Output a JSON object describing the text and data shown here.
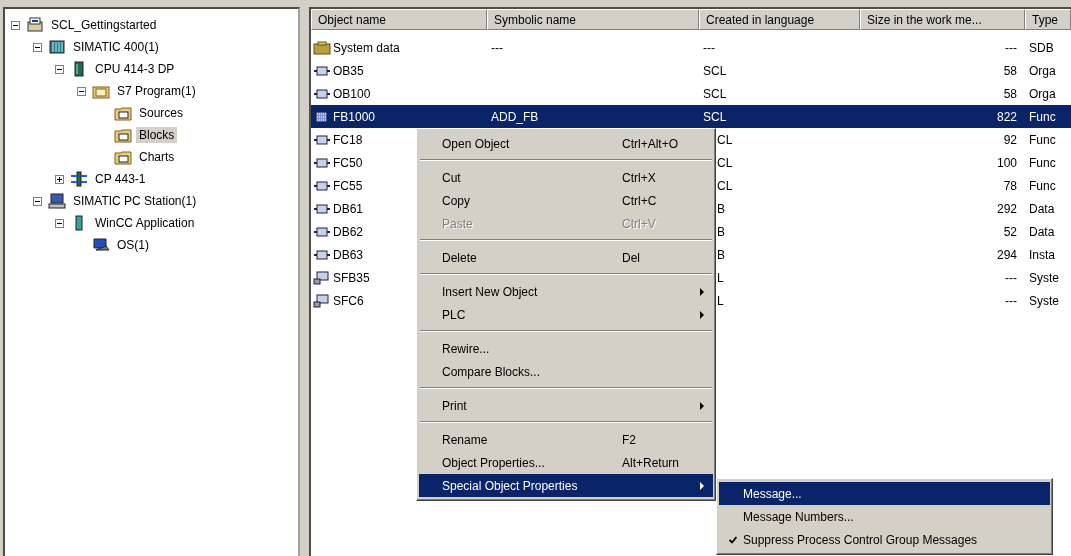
{
  "tree": [
    {
      "label": "SCL_Gettingstarted",
      "kind": "project",
      "expanded": true,
      "selected": false,
      "children": [
        {
          "label": "SIMATIC 400(1)",
          "kind": "station",
          "expanded": true,
          "selected": false,
          "children": [
            {
              "label": "CPU 414-3 DP",
              "kind": "cpu",
              "expanded": true,
              "selected": false,
              "children": [
                {
                  "label": "S7 Program(1)",
                  "kind": "program",
                  "expanded": true,
                  "selected": false,
                  "children": [
                    {
                      "label": "Sources",
                      "kind": "folder",
                      "selected": false
                    },
                    {
                      "label": "Blocks",
                      "kind": "folder",
                      "selected": true
                    },
                    {
                      "label": "Charts",
                      "kind": "folder",
                      "selected": false
                    }
                  ]
                }
              ]
            },
            {
              "label": "CP 443-1",
              "kind": "module",
              "expanded": false,
              "selected": false
            }
          ]
        },
        {
          "label": "SIMATIC PC Station(1)",
          "kind": "pc",
          "expanded": true,
          "selected": false,
          "children": [
            {
              "label": "WinCC Application",
              "kind": "application",
              "expanded": true,
              "selected": false,
              "children": [
                {
                  "label": "OS(1)",
                  "kind": "os",
                  "selected": false
                }
              ]
            }
          ]
        }
      ]
    }
  ],
  "table": {
    "columns": [
      "Object name",
      "Symbolic name",
      "Created in language",
      "Size in the work me...",
      "Type"
    ],
    "rows": [
      {
        "kind": "system",
        "name": "System data",
        "symbolic": "---",
        "language": "---",
        "size": "---",
        "type": "SDB",
        "selected": false
      },
      {
        "kind": "block",
        "name": "OB35",
        "language": "SCL",
        "size": "58",
        "type": "Orga",
        "selected": false
      },
      {
        "kind": "block",
        "name": "OB100",
        "language": "SCL",
        "size": "58",
        "type": "Orga",
        "selected": false
      },
      {
        "kind": "fb",
        "name": "FB1000",
        "symbolic": "ADD_FB",
        "language": "SCL",
        "size": "822",
        "type": "Func",
        "selected": true
      },
      {
        "kind": "block",
        "name": "FC18",
        "language": "CL",
        "size": "92",
        "type": "Func",
        "selected": false
      },
      {
        "kind": "block",
        "name": "FC50",
        "language": "CL",
        "size": "100",
        "type": "Func",
        "selected": false
      },
      {
        "kind": "block",
        "name": "FC55",
        "language": "CL",
        "size": "78",
        "type": "Func",
        "selected": false
      },
      {
        "kind": "block",
        "name": "DB61",
        "language": "B",
        "size": "292",
        "type": "Data",
        "selected": false
      },
      {
        "kind": "block",
        "name": "DB62",
        "language": "B",
        "size": "52",
        "type": "Data",
        "selected": false
      },
      {
        "kind": "block",
        "name": "DB63",
        "language": "B",
        "size": "294",
        "type": "Insta",
        "selected": false
      },
      {
        "kind": "sysblock",
        "name": "SFB35",
        "language": "L",
        "size": "---",
        "type": "Syste",
        "selected": false
      },
      {
        "kind": "sysblock",
        "name": "SFC6",
        "language": "L",
        "size": "---",
        "type": "Syste",
        "selected": false
      }
    ]
  },
  "context_menu": {
    "items": [
      {
        "kind": "item",
        "label": "Open Object",
        "shortcut": "Ctrl+Alt+O",
        "submenu": false,
        "disabled": false,
        "selected": false
      },
      {
        "kind": "separator"
      },
      {
        "kind": "item",
        "label": "Cut",
        "shortcut": "Ctrl+X",
        "submenu": false,
        "disabled": false,
        "selected": false
      },
      {
        "kind": "item",
        "label": "Copy",
        "shortcut": "Ctrl+C",
        "submenu": false,
        "disabled": false,
        "selected": false
      },
      {
        "kind": "item",
        "label": "Paste",
        "shortcut": "Ctrl+V",
        "submenu": false,
        "disabled": true,
        "selected": false
      },
      {
        "kind": "separator"
      },
      {
        "kind": "item",
        "label": "Delete",
        "shortcut": "Del",
        "submenu": false,
        "disabled": false,
        "selected": false
      },
      {
        "kind": "separator"
      },
      {
        "kind": "item",
        "label": "Insert New Object",
        "submenu": true,
        "disabled": false,
        "selected": false
      },
      {
        "kind": "item",
        "label": "PLC",
        "submenu": true,
        "disabled": false,
        "selected": false
      },
      {
        "kind": "separator"
      },
      {
        "kind": "item",
        "label": "Rewire...",
        "submenu": false,
        "disabled": false,
        "selected": false
      },
      {
        "kind": "item",
        "label": "Compare Blocks...",
        "submenu": false,
        "disabled": false,
        "selected": false
      },
      {
        "kind": "separator"
      },
      {
        "kind": "item",
        "label": "Print",
        "submenu": true,
        "disabled": false,
        "selected": false
      },
      {
        "kind": "separator"
      },
      {
        "kind": "item",
        "label": "Rename",
        "shortcut": "F2",
        "submenu": false,
        "disabled": false,
        "selected": false
      },
      {
        "kind": "item",
        "label": "Object Properties...",
        "shortcut": "Alt+Return",
        "submenu": false,
        "disabled": false,
        "selected": false
      },
      {
        "kind": "item",
        "label": "Special Object Properties",
        "submenu": true,
        "disabled": false,
        "selected": true
      }
    ]
  },
  "submenu": {
    "items": [
      {
        "label": "Message...",
        "checked": false,
        "selected": true
      },
      {
        "label": "Message Numbers...",
        "checked": false,
        "selected": false
      },
      {
        "label": "Suppress Process Control Group Messages",
        "checked": true,
        "selected": false
      }
    ]
  }
}
